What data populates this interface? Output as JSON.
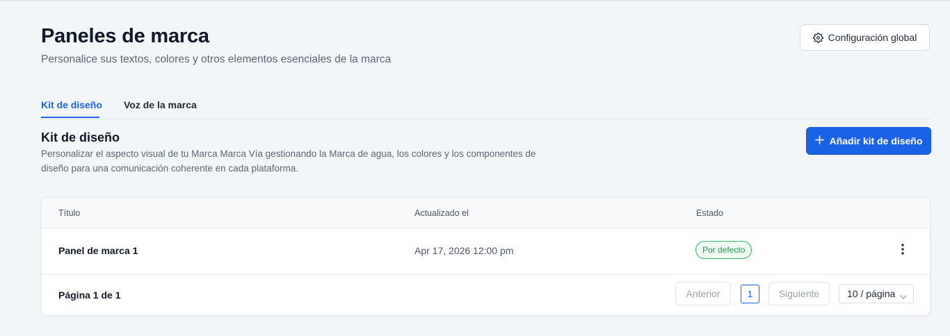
{
  "header": {
    "title": "Paneles de marca",
    "subtitle": "Personalice sus textos, colores y otros elementos esenciales de la marca",
    "global_config_label": "Configuración global"
  },
  "tabs": [
    {
      "label": "Kit de diseño",
      "active": true
    },
    {
      "label": "Voz de la marca",
      "active": false
    }
  ],
  "section": {
    "title": "Kit de diseño",
    "description": "Personalizar el aspecto visual de tu Marca Marca Vía gestionando la Marca de agua, los colores y los componentes de diseño para una comunicación coherente en cada plataforma.",
    "add_button_label": "Añadir kit de diseño"
  },
  "table": {
    "columns": [
      "Título",
      "Actualizado el",
      "Estado"
    ],
    "rows": [
      {
        "title": "Panel de marca 1",
        "updated": "Apr 17, 2026 12:00 pm",
        "status": "Por defecto"
      }
    ]
  },
  "pagination": {
    "info": "Página 1 de 1",
    "prev_label": "Anterior",
    "current_page": "1",
    "next_label": "Siguiente",
    "page_size": "10 / página"
  },
  "colors": {
    "accent": "#1a63e6",
    "status_default": "#1e9a55"
  },
  "icons": {
    "global_config": "gear-icon",
    "add": "plus-icon",
    "row_menu": "kebab-menu-icon",
    "page_size": "chevron-down-icon"
  }
}
